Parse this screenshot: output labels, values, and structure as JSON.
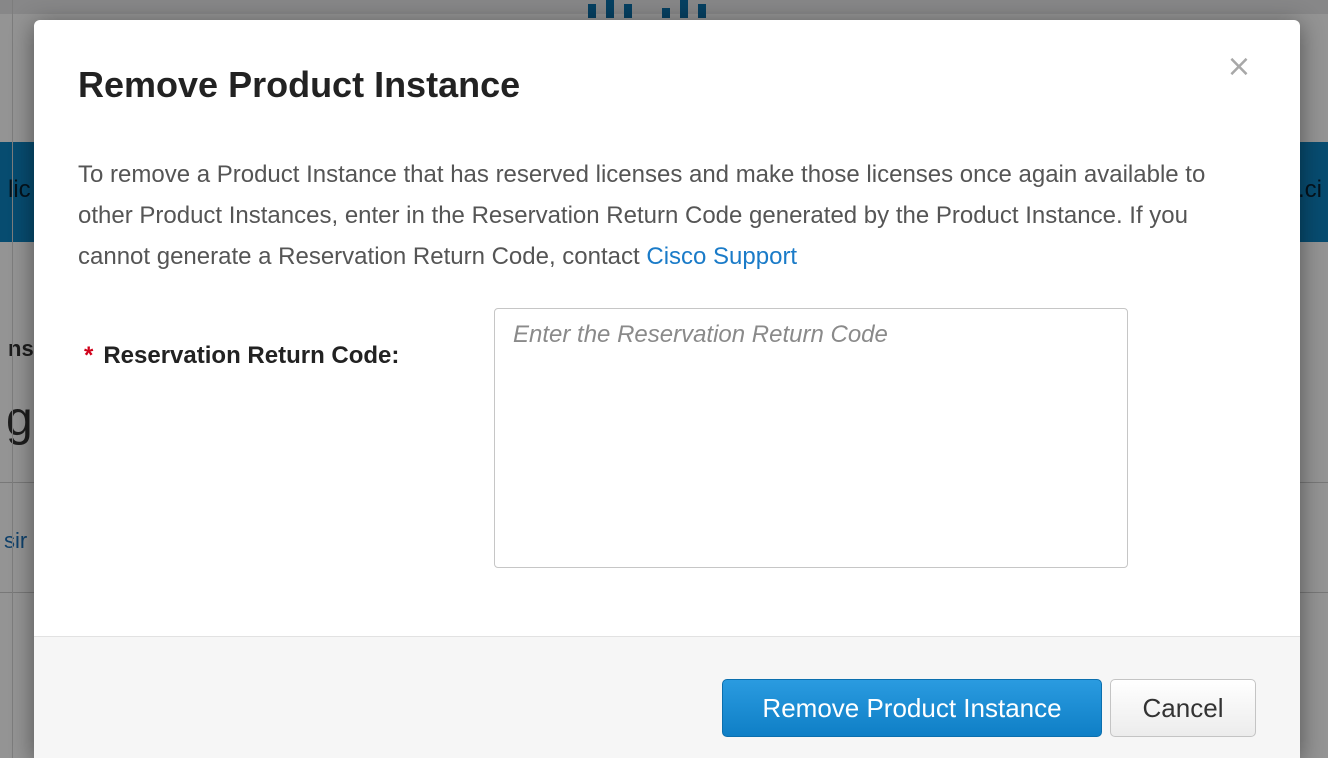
{
  "dialog": {
    "title": "Remove Product Instance",
    "close_glyph": "×",
    "description": "To remove a Product Instance that has reserved licenses and make those licenses once again available to other Product Instances, enter in the Reservation Return Code generated by the Product Instance. If you cannot generate a Reservation Return Code, contact ",
    "support_link": "Cisco Support"
  },
  "form": {
    "required_marker": "*",
    "label": "Reservation Return Code:",
    "placeholder": "Enter the Reservation Return Code",
    "value": ""
  },
  "footer": {
    "primary_label": "Remove Product Instance",
    "cancel_label": "Cancel"
  },
  "background": {
    "band_left": "lic",
    "band_right": ".ci",
    "heading": "ns",
    "big_text": "g",
    "link_text": "sir"
  },
  "icons": {
    "close": "close-icon"
  },
  "colors": {
    "primary": "#1a8ad4",
    "link": "#1a7bc8",
    "required": "#d0021b",
    "band": "#0d84c2"
  }
}
